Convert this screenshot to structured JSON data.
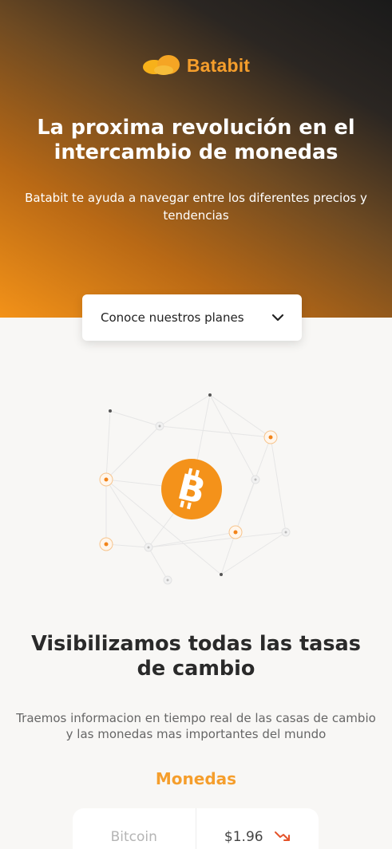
{
  "brand": {
    "name": "Batabit",
    "logo_icon": "coin-logo-icon",
    "accent": "#f59e2c"
  },
  "hero": {
    "title": "La proxima revolución en el intercambio de monedas",
    "subtitle": "Batabit te ayuda a navegar entre los diferentes precios y tendencias",
    "plans_button": "Conoce nuestros planes"
  },
  "section": {
    "title": "Visibilizamos todas las tasas de cambio",
    "subtitle": "Traemos informacion en tiempo real de las casas de cambio y las monedas mas importantes del mundo",
    "monedas_label": "Monedas"
  },
  "coins": [
    {
      "name": "Bitcoin",
      "price": "$1.96",
      "trend": "down",
      "trend_color": "#e4532a"
    }
  ],
  "icons": {
    "bitcoin": "bitcoin-icon",
    "chevron": "chevron-down-icon",
    "trend": "trend-down-icon"
  }
}
